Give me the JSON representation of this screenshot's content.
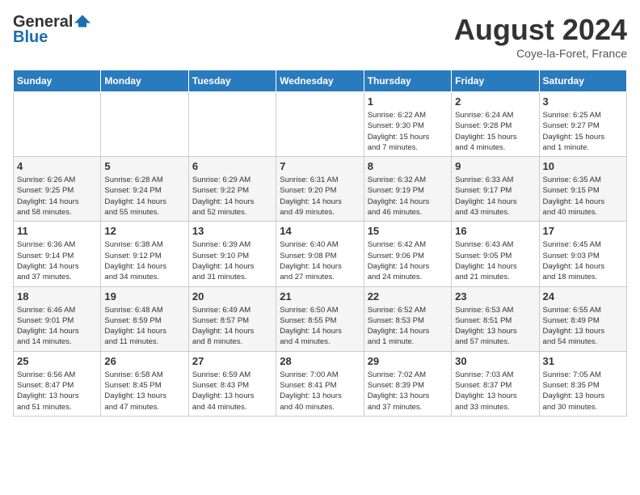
{
  "header": {
    "logo_general": "General",
    "logo_blue": "Blue",
    "month_year": "August 2024",
    "location": "Coye-la-Foret, France"
  },
  "days_of_week": [
    "Sunday",
    "Monday",
    "Tuesday",
    "Wednesday",
    "Thursday",
    "Friday",
    "Saturday"
  ],
  "weeks": [
    [
      {
        "day": "",
        "info": ""
      },
      {
        "day": "",
        "info": ""
      },
      {
        "day": "",
        "info": ""
      },
      {
        "day": "",
        "info": ""
      },
      {
        "day": "1",
        "info": "Sunrise: 6:22 AM\nSunset: 9:30 PM\nDaylight: 15 hours\nand 7 minutes."
      },
      {
        "day": "2",
        "info": "Sunrise: 6:24 AM\nSunset: 9:28 PM\nDaylight: 15 hours\nand 4 minutes."
      },
      {
        "day": "3",
        "info": "Sunrise: 6:25 AM\nSunset: 9:27 PM\nDaylight: 15 hours\nand 1 minute."
      }
    ],
    [
      {
        "day": "4",
        "info": "Sunrise: 6:26 AM\nSunset: 9:25 PM\nDaylight: 14 hours\nand 58 minutes."
      },
      {
        "day": "5",
        "info": "Sunrise: 6:28 AM\nSunset: 9:24 PM\nDaylight: 14 hours\nand 55 minutes."
      },
      {
        "day": "6",
        "info": "Sunrise: 6:29 AM\nSunset: 9:22 PM\nDaylight: 14 hours\nand 52 minutes."
      },
      {
        "day": "7",
        "info": "Sunrise: 6:31 AM\nSunset: 9:20 PM\nDaylight: 14 hours\nand 49 minutes."
      },
      {
        "day": "8",
        "info": "Sunrise: 6:32 AM\nSunset: 9:19 PM\nDaylight: 14 hours\nand 46 minutes."
      },
      {
        "day": "9",
        "info": "Sunrise: 6:33 AM\nSunset: 9:17 PM\nDaylight: 14 hours\nand 43 minutes."
      },
      {
        "day": "10",
        "info": "Sunrise: 6:35 AM\nSunset: 9:15 PM\nDaylight: 14 hours\nand 40 minutes."
      }
    ],
    [
      {
        "day": "11",
        "info": "Sunrise: 6:36 AM\nSunset: 9:14 PM\nDaylight: 14 hours\nand 37 minutes."
      },
      {
        "day": "12",
        "info": "Sunrise: 6:38 AM\nSunset: 9:12 PM\nDaylight: 14 hours\nand 34 minutes."
      },
      {
        "day": "13",
        "info": "Sunrise: 6:39 AM\nSunset: 9:10 PM\nDaylight: 14 hours\nand 31 minutes."
      },
      {
        "day": "14",
        "info": "Sunrise: 6:40 AM\nSunset: 9:08 PM\nDaylight: 14 hours\nand 27 minutes."
      },
      {
        "day": "15",
        "info": "Sunrise: 6:42 AM\nSunset: 9:06 PM\nDaylight: 14 hours\nand 24 minutes."
      },
      {
        "day": "16",
        "info": "Sunrise: 6:43 AM\nSunset: 9:05 PM\nDaylight: 14 hours\nand 21 minutes."
      },
      {
        "day": "17",
        "info": "Sunrise: 6:45 AM\nSunset: 9:03 PM\nDaylight: 14 hours\nand 18 minutes."
      }
    ],
    [
      {
        "day": "18",
        "info": "Sunrise: 6:46 AM\nSunset: 9:01 PM\nDaylight: 14 hours\nand 14 minutes."
      },
      {
        "day": "19",
        "info": "Sunrise: 6:48 AM\nSunset: 8:59 PM\nDaylight: 14 hours\nand 11 minutes."
      },
      {
        "day": "20",
        "info": "Sunrise: 6:49 AM\nSunset: 8:57 PM\nDaylight: 14 hours\nand 8 minutes."
      },
      {
        "day": "21",
        "info": "Sunrise: 6:50 AM\nSunset: 8:55 PM\nDaylight: 14 hours\nand 4 minutes."
      },
      {
        "day": "22",
        "info": "Sunrise: 6:52 AM\nSunset: 8:53 PM\nDaylight: 14 hours\nand 1 minute."
      },
      {
        "day": "23",
        "info": "Sunrise: 6:53 AM\nSunset: 8:51 PM\nDaylight: 13 hours\nand 57 minutes."
      },
      {
        "day": "24",
        "info": "Sunrise: 6:55 AM\nSunset: 8:49 PM\nDaylight: 13 hours\nand 54 minutes."
      }
    ],
    [
      {
        "day": "25",
        "info": "Sunrise: 6:56 AM\nSunset: 8:47 PM\nDaylight: 13 hours\nand 51 minutes."
      },
      {
        "day": "26",
        "info": "Sunrise: 6:58 AM\nSunset: 8:45 PM\nDaylight: 13 hours\nand 47 minutes."
      },
      {
        "day": "27",
        "info": "Sunrise: 6:59 AM\nSunset: 8:43 PM\nDaylight: 13 hours\nand 44 minutes."
      },
      {
        "day": "28",
        "info": "Sunrise: 7:00 AM\nSunset: 8:41 PM\nDaylight: 13 hours\nand 40 minutes."
      },
      {
        "day": "29",
        "info": "Sunrise: 7:02 AM\nSunset: 8:39 PM\nDaylight: 13 hours\nand 37 minutes."
      },
      {
        "day": "30",
        "info": "Sunrise: 7:03 AM\nSunset: 8:37 PM\nDaylight: 13 hours\nand 33 minutes."
      },
      {
        "day": "31",
        "info": "Sunrise: 7:05 AM\nSunset: 8:35 PM\nDaylight: 13 hours\nand 30 minutes."
      }
    ]
  ]
}
